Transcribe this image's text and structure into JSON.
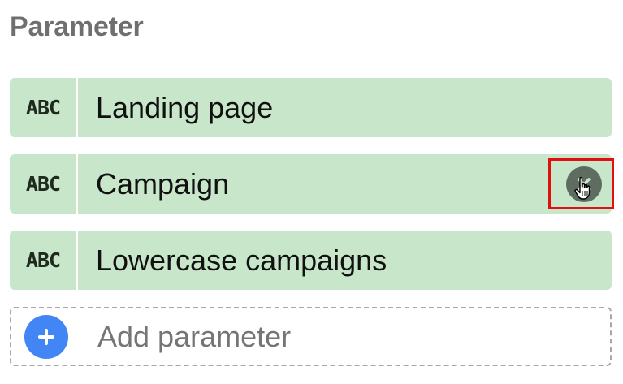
{
  "section": {
    "title": "Parameter"
  },
  "parameters": [
    {
      "type_label": "ABC",
      "name": "Landing page"
    },
    {
      "type_label": "ABC",
      "name": "Campaign"
    },
    {
      "type_label": "ABC",
      "name": "Lowercase campaigns"
    }
  ],
  "add_parameter": {
    "label": "Add parameter",
    "icon": "plus-icon"
  },
  "icons": {
    "chip_action": "close-icon",
    "cursor": "hand-pointer-icon"
  },
  "colors": {
    "chip_background": "#c8e6c9",
    "add_button": "#4285f4",
    "highlight": "#e01010",
    "action_circle": "#5f6d61"
  }
}
